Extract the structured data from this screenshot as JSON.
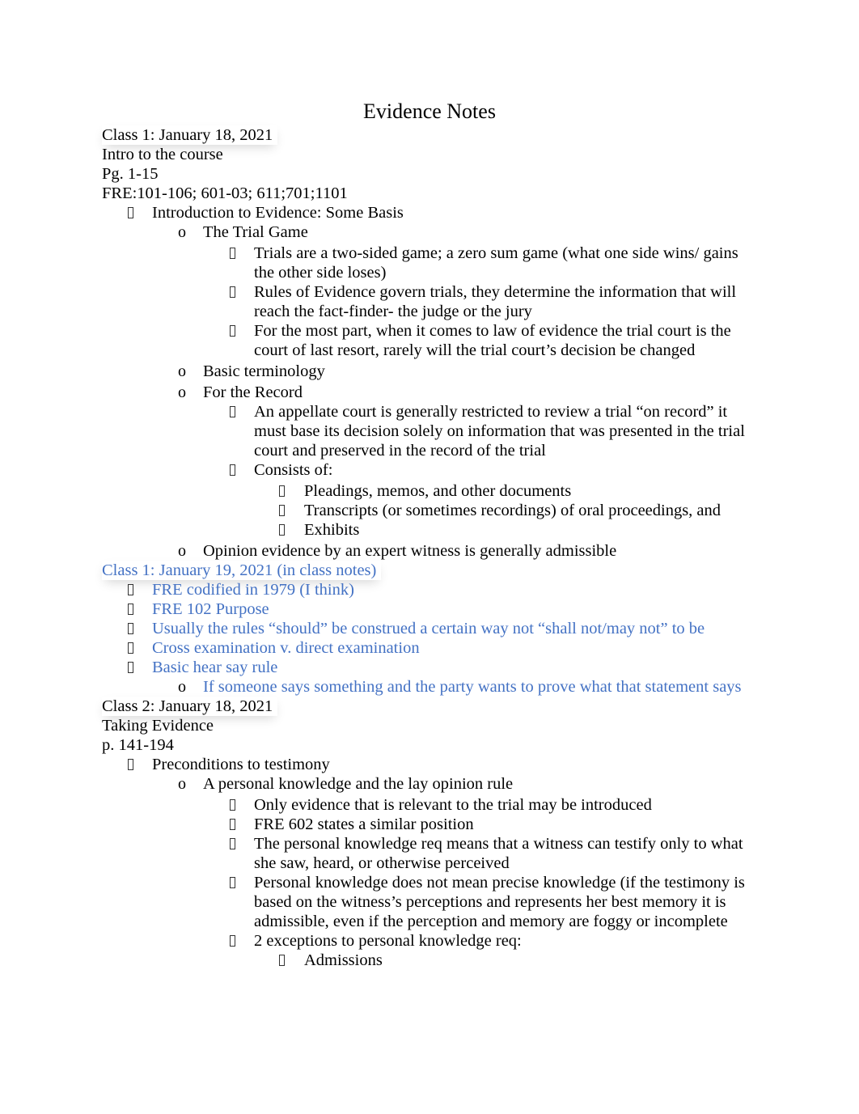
{
  "document": {
    "title": "Evidence Notes",
    "accent_color": "#4472c4",
    "bullet_icons": {
      "level1": "missing-glyph-box",
      "level2": "letter-o",
      "level3": "missing-glyph-box",
      "level4": "missing-glyph-box"
    }
  },
  "sections": {
    "class1": {
      "heading": "Class 1: January 18, 2021",
      "topic": "Intro to the course",
      "pages": "Pg. 1-15",
      "rules": "FRE:101-106; 601-03; 611;701;1101",
      "items": {
        "intro": "Introduction to Evidence: Some Basis",
        "trial_game": "The Trial Game",
        "trial_game_points": [
          "Trials are a two-sided game; a zero sum game (what one side wins/ gains the other side loses)",
          "Rules of Evidence govern trials, they determine the information that will reach the fact-finder- the judge or the jury",
          "For the most part, when it comes to law of evidence the trial court is the court of last resort, rarely will the trial court’s decision be changed"
        ],
        "basic_terminology": "Basic terminology",
        "for_the_record": "For the Record",
        "record_points": [
          "An appellate court is generally restricted to review a trial “on record” it must base its decision solely on information that was presented in the trial court and preserved in the record of the trial",
          "Consists of:"
        ],
        "consists_of": [
          "Pleadings, memos, and other documents",
          "Transcripts (or sometimes recordings) of oral proceedings, and",
          "Exhibits"
        ],
        "opinion_evidence": "Opinion evidence by an expert witness is generally admissible"
      }
    },
    "class1_in_class": {
      "heading": "Class 1: January 19, 2021 (in class notes)",
      "items": [
        "FRE codified in 1979 (I think)",
        "FRE 102 Purpose",
        "Usually the rules “should” be construed a certain way not “shall not/may not” to be",
        "Cross examination v. direct examination",
        "Basic hear say rule"
      ],
      "hearsay_sub": "If someone says something and the party wants to prove what that statement says"
    },
    "class2": {
      "heading": "Class 2: January 18, 2021",
      "topic": "Taking Evidence",
      "pages": "p. 141-194",
      "items": {
        "preconditions": "Preconditions to testimony",
        "personal_knowledge": "A personal knowledge and the lay opinion rule",
        "points": [
          "Only evidence that is relevant to the trial may be introduced",
          "FRE 602 states a similar position",
          "The personal knowledge req means that a witness can testify only to what she saw, heard, or otherwise perceived",
          "Personal knowledge does not mean precise knowledge (if the testimony is based on the witness’s perceptions and represents her best memory it is admissible, even if the perception and memory are foggy or incomplete",
          "2 exceptions to personal knowledge req:"
        ],
        "exceptions": [
          "Admissions"
        ]
      }
    }
  }
}
